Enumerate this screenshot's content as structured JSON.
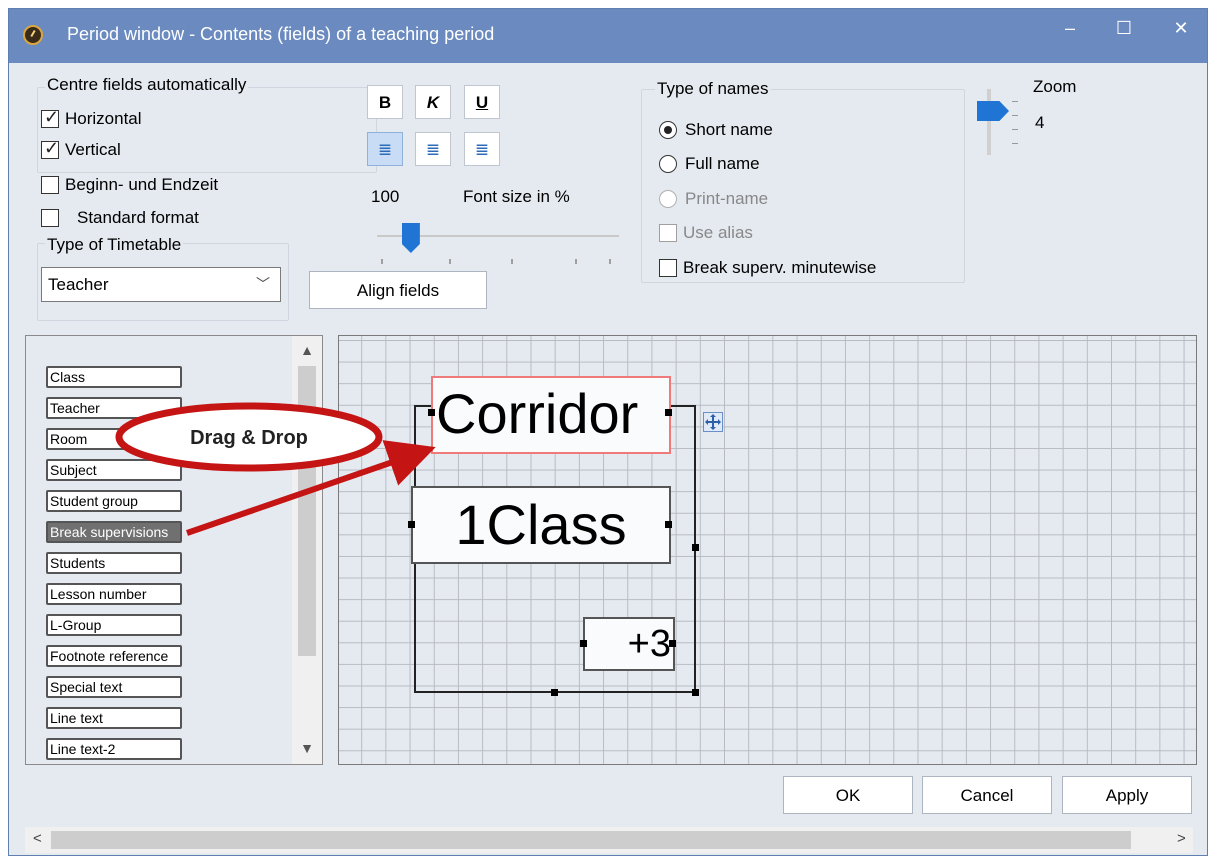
{
  "window": {
    "title": "Period window - Contents (fields) of a teaching period",
    "min": "‒",
    "max": "☐",
    "close": "✕"
  },
  "centre": {
    "label": "Centre fields automatically",
    "horizontal": "Horizontal",
    "vertical": "Vertical",
    "times": "Beginn- und Endzeit",
    "standard": "Standard format"
  },
  "timetable": {
    "label": "Type of Timetable",
    "value": "Teacher"
  },
  "format": {
    "bold": "B",
    "italic": "K",
    "underline": "U",
    "align_left": "≣",
    "align_center": "≣",
    "align_right": "≣",
    "font_size_value": "100",
    "font_size_label": "Font size in %",
    "font_size_percent": 0.14,
    "align_fields": "Align fields"
  },
  "names": {
    "label": "Type of names",
    "short": "Short name",
    "full": "Full name",
    "print": "Print-name",
    "alias": "Use alias",
    "break": "Break superv. minutewise",
    "selected": "short"
  },
  "zoom": {
    "label": "Zoom",
    "value": "4"
  },
  "field_list": [
    "Class",
    "Teacher",
    "Room",
    "Subject",
    "Student group",
    "Break supervisions",
    "Students",
    "Lesson number",
    "L-Group",
    "Footnote reference",
    "Special text",
    "Line text",
    "Line text-2"
  ],
  "selected_field": "Break supervisions",
  "scroll": {
    "up": "▲",
    "down": "▼",
    "left": "<",
    "right": ">"
  },
  "canvas": {
    "field1": "Corridor",
    "field2": "1Class",
    "field3": "+3"
  },
  "callout": "Drag & Drop",
  "buttons": {
    "ok": "OK",
    "cancel": "Cancel",
    "apply": "Apply"
  },
  "colors": {
    "titlebar": "#6b8bc0",
    "callout": "#c41414",
    "selection": "#f07a7a"
  }
}
